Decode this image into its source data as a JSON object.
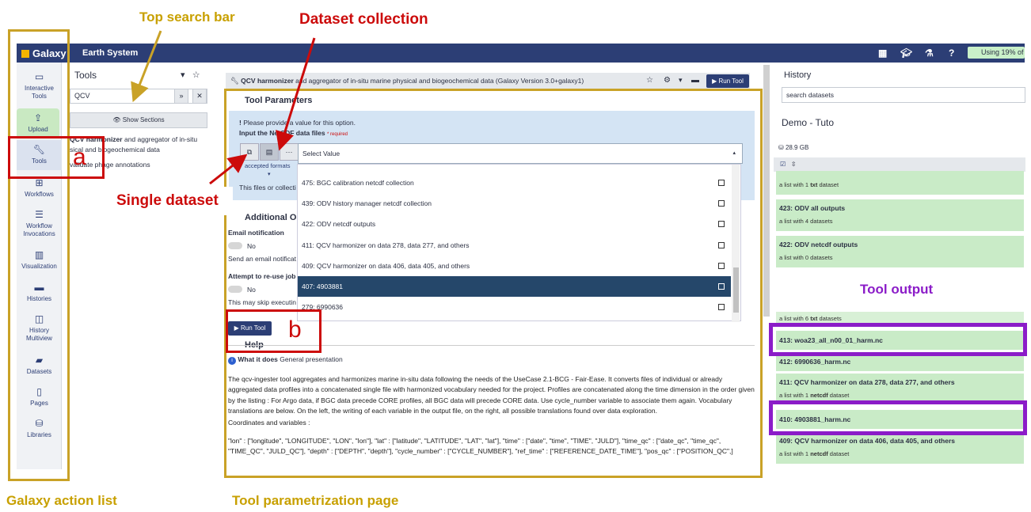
{
  "annotations": {
    "top_search_bar": "Top search bar",
    "dataset_collection": "Dataset collection",
    "single_dataset": "Single dataset",
    "tool_output": "Tool output",
    "galaxy_action_list": "Galaxy action list",
    "tool_parametrization_page": "Tool parametrization page",
    "marker_a": "a",
    "marker_b": "b"
  },
  "topbar": {
    "brand": "Galaxy",
    "title": "Earth System",
    "usage": "Using 19% of"
  },
  "actions": [
    "Interactive Tools",
    "Upload",
    "Tools",
    "Workflows",
    "Workflow Invocations",
    "Visualization",
    "Histories",
    "History Multiview",
    "Datasets",
    "Pages",
    "Libraries"
  ],
  "tools_panel": {
    "title": "Tools",
    "search_value": "QCV",
    "show_sections": "Show Sections",
    "item1_bold": "QCV harmonizer",
    "item1_rest": " and aggregator of in-situ",
    "item1_line2": "sical and biogeochemical data",
    "item2": "validate phage annotations"
  },
  "center": {
    "tool_title_bold": "QCV harmonizer",
    "tool_title_rest": " and aggregator of in-situ marine physical and biogeochemical data (Galaxy Version 3.0+galaxy1)",
    "run_tool": "Run Tool",
    "tool_parameters": "Tool Parameters",
    "notice": "Please provide a value for this option.",
    "input_label": "Input the NetCDF data files",
    "required": "* required",
    "accepted_formats": "accepted formats",
    "select_value": "Select Value",
    "files_note": "This files or collecti",
    "additional_options": "Additional Op",
    "email_notification": "Email notification",
    "no": "No",
    "email_note": "Send an email notificat",
    "reuse_jobs": "Attempt to re-use job",
    "reuse_note": "This may skip executin",
    "run_tool_small": "Run Tool",
    "help": "Help",
    "what_it_does": "What it does",
    "general_presentation": "General presentation"
  },
  "dropdown_items": [
    "475: BGC calibration netcdf collection",
    "439: ODV history manager netcdf collection",
    "422: ODV netcdf outputs",
    "411: QCV harmonizer on data 278, data 277, and others",
    "409: QCV harmonizer on data 406, data 405, and others",
    "407: 4903881",
    "279: 6990636"
  ],
  "help_text": {
    "p1": "The qcv-ingester tool aggregates and harmonizes marine in-situ data following the needs of the UseCase 2.1-BCG - Fair-Ease. It converts files of individual or already aggregated data profiles into a concatenated single file with harmonized vocabulary needed for the project. Profiles are concatenated along the time dimension in the order given by the listing : For Argo data, if BGC data precede CORE profiles, all BGC data will precede CORE data. Use cycle_number variable to associate them again. Vocabulary translations are below. On the left, the writing of each variable in the output file, on the right, all possible translations found over data exploration.",
    "p2": "Coordinates and variables :",
    "p3": "\"lon\" : [\"longitude\", \"LONGITUDE\", \"LON\", \"lon\"], \"lat\" : [\"latitude\", \"LATITUDE\", \"LAT\", \"lat\"], \"time\" : [\"date\", \"time\", \"TIME\", \"JULD\"], \"time_qc\" : [\"date_qc\", \"time_qc\", \"TIME_QC\", \"JULD_QC\"], \"depth\" : [\"DEPTH\", \"depth\"], \"cycle_number\" : [\"CYCLE_NUMBER\"], \"ref_time\" : [\"REFERENCE_DATE_TIME\"], \"pos_qc\" : [\"POSITION_QC\",]"
  },
  "history": {
    "title": "History",
    "search_placeholder": "search datasets",
    "name": "Demo - Tuto",
    "size": "28.9 GB",
    "items": [
      {
        "title": "",
        "sub_pre": "a list with 1 ",
        "sub_bold": "txt",
        "sub_post": " dataset"
      },
      {
        "title": "423: ODV all outputs",
        "sub_pre": "a list with 4 datasets",
        "sub_bold": "",
        "sub_post": ""
      },
      {
        "title": "422: ODV netcdf outputs",
        "sub_pre": "a list with 0 datasets",
        "sub_bold": "",
        "sub_post": ""
      },
      {
        "title": "",
        "sub_pre": "a list with 6 ",
        "sub_bold": "txt",
        "sub_post": " datasets"
      },
      {
        "title": "413: woa23_all_n00_01_harm.nc",
        "sub_pre": "",
        "sub_bold": "",
        "sub_post": ""
      },
      {
        "title": "412: 6990636_harm.nc",
        "sub_pre": "",
        "sub_bold": "",
        "sub_post": ""
      },
      {
        "title": "411: QCV harmonizer on data 278, data 277, and others",
        "sub_pre": "a list with 1 ",
        "sub_bold": "netcdf",
        "sub_post": " dataset"
      },
      {
        "title": "410: 4903881_harm.nc",
        "sub_pre": "",
        "sub_bold": "",
        "sub_post": ""
      },
      {
        "title": "409: QCV harmonizer on data 406, data 405, and others",
        "sub_pre": "a list with 1 ",
        "sub_bold": "netcdf",
        "sub_post": " dataset"
      }
    ]
  },
  "colors": {
    "navbar": "#2c3e75",
    "annotation_gold": "#c9a227",
    "annotation_red": "#cc0b0b",
    "annotation_purple": "#8b1cc8",
    "history_green": "#c9ebc7",
    "selected_row": "#25476a"
  }
}
